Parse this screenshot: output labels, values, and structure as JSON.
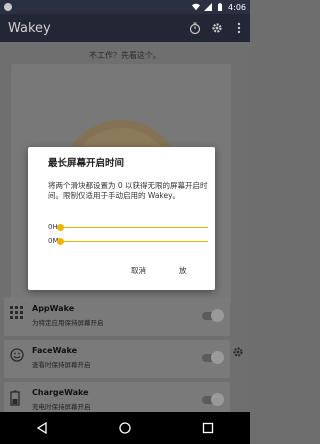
{
  "status_bar": {
    "time": "4:06"
  },
  "app_bar": {
    "title": "Wakey"
  },
  "hint_text": "不工作？先看这个。",
  "rows": [
    {
      "title": "AppWake",
      "subtitle": "为特定应用保持屏幕开启",
      "enabled": false
    },
    {
      "title": "FaceWake",
      "subtitle": "查看时保持屏幕开启",
      "enabled": false
    },
    {
      "title": "ChargeWake",
      "subtitle": "充电时保持屏幕开启",
      "enabled": false
    }
  ],
  "dialog": {
    "title": "最长屏幕开启时间",
    "body": "将两个滑块都设置为 0 以获得无限的屏幕开启时间。限制仅适用于手动启用的 Wakey。",
    "sliders": [
      {
        "label": "0H",
        "value": 0
      },
      {
        "label": "0M",
        "value": 0
      }
    ],
    "cancel_label": "取消",
    "ok_label": "放"
  },
  "colors": {
    "accent": "#f0b400",
    "statusbar": "#2a2f42",
    "appbar": "#232634"
  }
}
